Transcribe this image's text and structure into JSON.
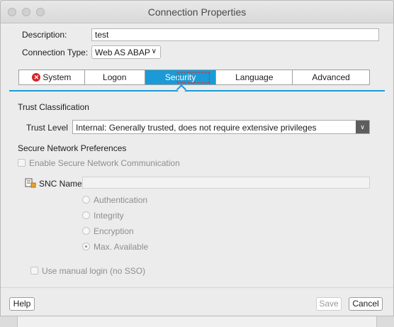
{
  "window": {
    "title": "Connection Properties"
  },
  "form": {
    "description_label": "Description:",
    "description_value": "test",
    "connection_type_label": "Connection Type:",
    "connection_type_value": "Web AS ABAP"
  },
  "tabs": [
    {
      "label": "System",
      "status": "error"
    },
    {
      "label": "Logon"
    },
    {
      "label": "Security",
      "active": true
    },
    {
      "label": "Language"
    },
    {
      "label": "Advanced"
    }
  ],
  "trust": {
    "section_title": "Trust Classification",
    "level_label": "Trust Level",
    "level_value": "Internal: Generally trusted, does not require extensive privileges"
  },
  "snc": {
    "section_title": "Secure Network Preferences",
    "enable_label": "Enable Secure Network Communication",
    "name_label": "SNC Name",
    "name_value": "",
    "options": [
      {
        "label": "Authentication",
        "checked": false
      },
      {
        "label": "Integrity",
        "checked": false
      },
      {
        "label": "Encryption",
        "checked": false
      },
      {
        "label": "Max. Available",
        "checked": true
      }
    ],
    "manual_login_label": "Use manual login (no SSO)"
  },
  "footer": {
    "help_label": "Help",
    "save_label": "Save",
    "cancel_label": "Cancel"
  },
  "colors": {
    "accent": "#1a9ad6",
    "error": "#d72424"
  }
}
